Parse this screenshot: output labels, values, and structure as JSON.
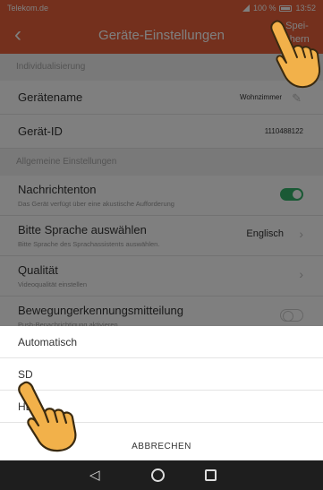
{
  "statusbar": {
    "carrier": "Telekom.de",
    "battery": "100 %",
    "time": "13:52"
  },
  "header": {
    "back_icon": "‹",
    "title": "Geräte-Einstellungen",
    "save": "Spei-chern"
  },
  "sections": {
    "individual": "Individualisierung",
    "general": "Allgemeine Einstellungen"
  },
  "rows": {
    "device_name": {
      "label": "Gerätename",
      "value": "Wohnzimmer"
    },
    "device_id": {
      "label": "Gerät-ID",
      "value": "1110488122"
    },
    "notify": {
      "label": "Nachrichtenton",
      "sub": "Das Gerät verfügt über eine akustische Aufforderung"
    },
    "language": {
      "label": "Bitte Sprache auswählen",
      "sub": "Bitte Sprache des Sprachassistents auswählen.",
      "value": "Englisch"
    },
    "quality": {
      "label": "Qualität",
      "sub": "Videoqualität einstellen"
    },
    "motion": {
      "label": "Bewegungerkennungsmitteilung",
      "sub": "Push-Benachrichtigung aktivieren"
    }
  },
  "sheet": {
    "options": [
      "Automatisch",
      "SD",
      "HD"
    ],
    "cancel": "ABBRECHEN"
  },
  "colors": {
    "accent": "#e8613a",
    "toggle_on": "#35b26b",
    "hand": "#f2b14a"
  }
}
